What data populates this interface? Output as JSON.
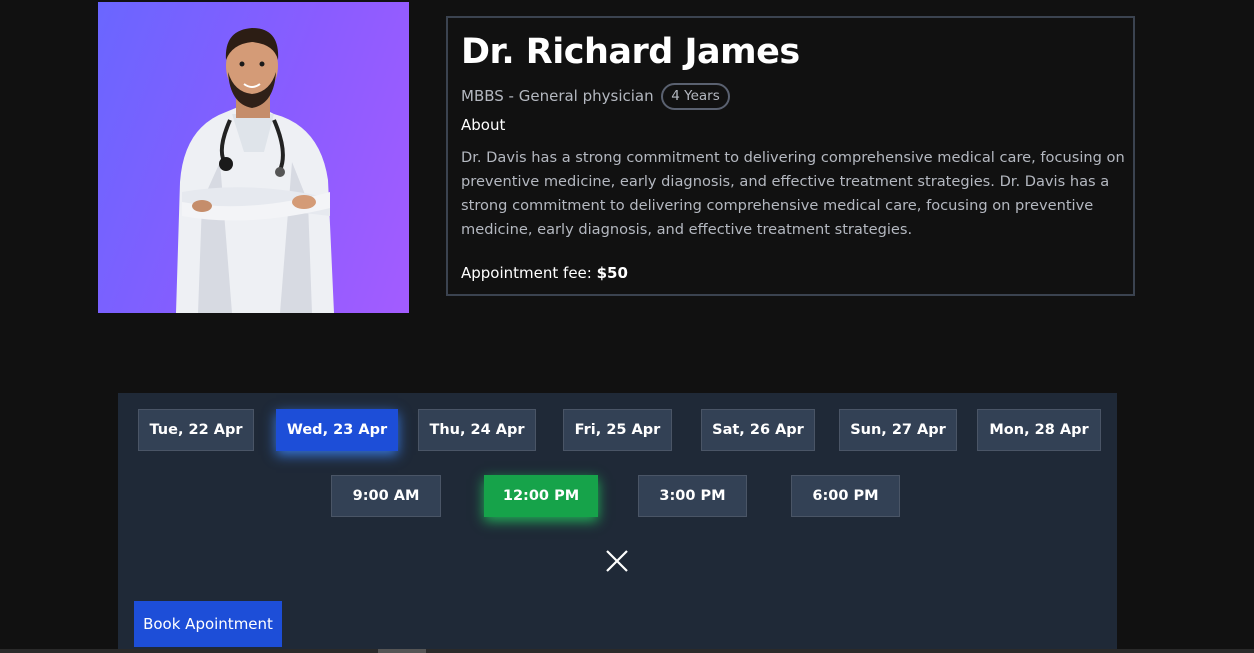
{
  "doctor": {
    "name": "Dr. Richard James",
    "degree": "MBBS - General physician",
    "experience": "4 Years",
    "about_label": "About",
    "about_text": "Dr. Davis has a strong commitment to delivering comprehensive medical care, focusing on preventive medicine, early diagnosis, and effective treatment strategies. Dr. Davis has a strong commitment to delivering comprehensive medical care, focusing on preventive medicine, early diagnosis, and effective treatment strategies.",
    "fee_label": "Appointment fee:",
    "fee_value": "$50"
  },
  "booking": {
    "dates": [
      {
        "label": "Tue, 22 Apr",
        "selected": false
      },
      {
        "label": "Wed, 23 Apr",
        "selected": true
      },
      {
        "label": "Thu, 24 Apr",
        "selected": false
      },
      {
        "label": "Fri, 25 Apr",
        "selected": false
      },
      {
        "label": "Sat, 26 Apr",
        "selected": false
      },
      {
        "label": "Sun, 27 Apr",
        "selected": false
      },
      {
        "label": "Mon, 28 Apr",
        "selected": false
      }
    ],
    "times": [
      {
        "label": "9:00 AM",
        "selected": false
      },
      {
        "label": "12:00 PM",
        "selected": true
      },
      {
        "label": "3:00 PM",
        "selected": false
      },
      {
        "label": "6:00 PM",
        "selected": false
      }
    ],
    "book_label": "Book Apointment"
  },
  "colors": {
    "page_bg": "#111111",
    "panel_bg": "#1f2937",
    "chip_bg": "#334155",
    "selected_date": "#1d4ed8",
    "selected_time": "#16a34a",
    "primary_button": "#1d4ed8"
  },
  "icons": {
    "close": "close-icon",
    "photo": "doctor-photo"
  }
}
